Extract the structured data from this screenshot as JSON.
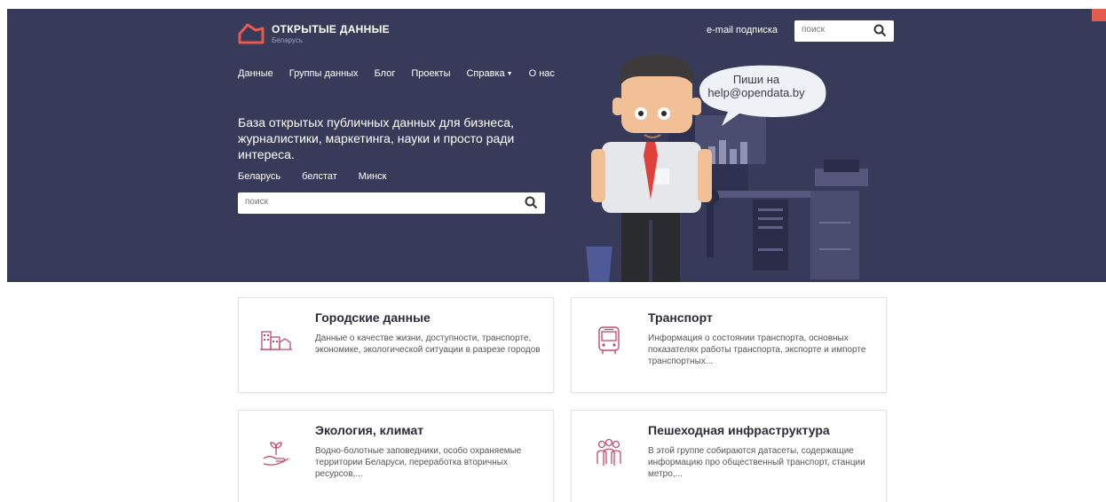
{
  "header": {
    "logo_title": "ОТКРЫТЫЕ ДАННЫЕ",
    "logo_subtitle": "Беларусь",
    "subscribe_label": "e-mail подписка",
    "search_placeholder": "поиск"
  },
  "nav": {
    "items": [
      {
        "label": "Данные"
      },
      {
        "label": "Группы данных"
      },
      {
        "label": "Блог"
      },
      {
        "label": "Проекты"
      },
      {
        "label": "Справка"
      },
      {
        "label": "О нас"
      }
    ]
  },
  "hero": {
    "tagline": "База открытых публичных данных для бизнеса, журналистики, маркетинга, науки и просто ради интереса.",
    "tags": [
      "Беларусь",
      "белстат",
      "Минск"
    ],
    "search_placeholder": "поиск",
    "bubble_text_line1": "Пиши на",
    "bubble_text_line2": "help@opendata.by"
  },
  "cards": [
    {
      "title": "Городские данные",
      "description": "Данные о качестве жизни, доступности, транспорте, экономике, экологической ситуации в разрезе городов",
      "icon": "city-icon"
    },
    {
      "title": "Транспорт",
      "description": "Информация о состоянии транспорта, основных показателях работы транспорта, экспорте и импорте транспортных...",
      "icon": "bus-icon"
    },
    {
      "title": "Экология, климат",
      "description": "Водно-болотные заповедники, особо охраняемые территории Беларуси, переработка вторичных ресурсов,...",
      "icon": "plant-hand-icon"
    },
    {
      "title": "Пешеходная инфраструктура",
      "description": "В этой группе собираются датасеты, содержащие информацию про общественный транспорт, станции метро,...",
      "icon": "people-icon"
    }
  ],
  "colors": {
    "hero_bg": "#383a5a",
    "accent": "#e55b4d",
    "card_icon": "#c24a6e"
  }
}
